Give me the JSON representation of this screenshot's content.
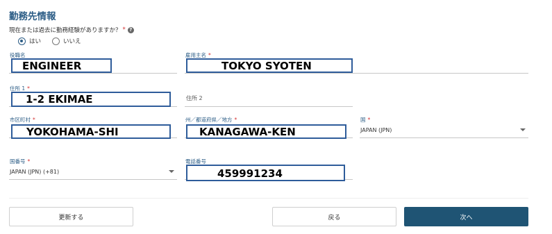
{
  "section": {
    "title": "勤務先情報",
    "question": "現在または過去に勤務経験がありますか？",
    "required_mark": "*",
    "help_icon": "?",
    "options": [
      {
        "label": "はい",
        "selected": true
      },
      {
        "label": "いいえ",
        "selected": false
      }
    ]
  },
  "fields": {
    "job_title": {
      "label": "役職名",
      "value": "ENGINEER"
    },
    "employer": {
      "label": "雇用主名",
      "required": "*",
      "value": "TOKYO SYOTEN"
    },
    "address1": {
      "label": "住所 1",
      "required": "*",
      "value": "1-2 EKIMAE"
    },
    "address2": {
      "placeholder": "住所 2"
    },
    "city": {
      "label": "市区町村",
      "required": "*",
      "value": "YOKOHAMA-SHI"
    },
    "state": {
      "label": "州／都道府県／地方",
      "required": "*",
      "value": "KANAGAWA-KEN"
    },
    "country": {
      "label": "国",
      "required": "*",
      "value": "JAPAN (JPN)"
    },
    "country_code": {
      "label": "国番号",
      "required": "*",
      "value": "JAPAN (JPN) (+81)"
    },
    "phone": {
      "label": "電話番号",
      "value": "459991234"
    }
  },
  "buttons": {
    "update": "更新する",
    "back": "戻る",
    "next": "次へ"
  },
  "colors": {
    "accent": "#2c5d86",
    "required": "#d32f2f",
    "primary_button": "#1f5474",
    "highlight_border": "#2e5c9a"
  }
}
